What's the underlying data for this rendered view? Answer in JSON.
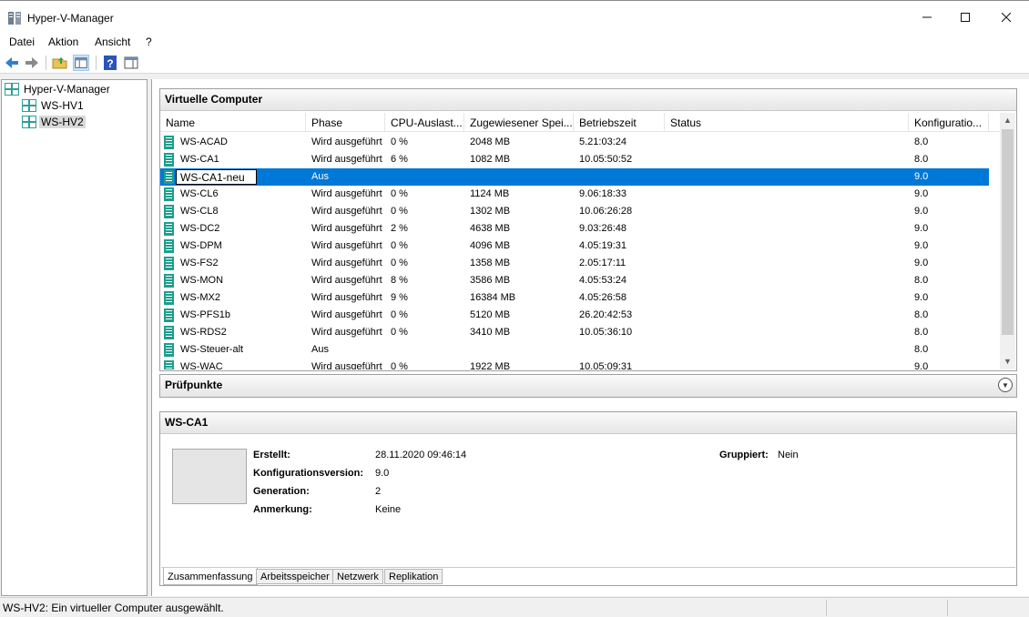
{
  "window": {
    "title": "Hyper-V-Manager"
  },
  "menu": {
    "items": [
      "Datei",
      "Aktion",
      "Ansicht",
      "?"
    ]
  },
  "tree": {
    "root": "Hyper-V-Manager",
    "servers": [
      "WS-HV1",
      "WS-HV2"
    ],
    "selected": "WS-HV2"
  },
  "vm_section": {
    "title": "Virtuelle Computer",
    "columns": [
      "Name",
      "Phase",
      "CPU-Auslast...",
      "Zugewiesener Spei...",
      "Betriebszeit",
      "Status",
      "Konfiguratio..."
    ],
    "rows": [
      {
        "name": "WS-ACAD",
        "phase": "Wird ausgeführt",
        "cpu": "0 %",
        "mem": "2048 MB",
        "uptime": "5.21:03:24",
        "status": "",
        "config": "8.0"
      },
      {
        "name": "WS-CA1",
        "phase": "Wird ausgeführt",
        "cpu": "6 %",
        "mem": "1082 MB",
        "uptime": "10.05:50:52",
        "status": "",
        "config": "8.0"
      },
      {
        "name": "WS-CA1-neu",
        "phase": "Aus",
        "cpu": "",
        "mem": "",
        "uptime": "",
        "status": "",
        "config": "9.0",
        "selected": true,
        "editing": true
      },
      {
        "name": "WS-CL6",
        "phase": "Wird ausgeführt",
        "cpu": "0 %",
        "mem": "1124 MB",
        "uptime": "9.06:18:33",
        "status": "",
        "config": "9.0"
      },
      {
        "name": "WS-CL8",
        "phase": "Wird ausgeführt",
        "cpu": "0 %",
        "mem": "1302 MB",
        "uptime": "10.06:26:28",
        "status": "",
        "config": "9.0"
      },
      {
        "name": "WS-DC2",
        "phase": "Wird ausgeführt",
        "cpu": "2 %",
        "mem": "4638 MB",
        "uptime": "9.03:26:48",
        "status": "",
        "config": "9.0"
      },
      {
        "name": "WS-DPM",
        "phase": "Wird ausgeführt",
        "cpu": "0 %",
        "mem": "4096 MB",
        "uptime": "4.05:19:31",
        "status": "",
        "config": "9.0"
      },
      {
        "name": "WS-FS2",
        "phase": "Wird ausgeführt",
        "cpu": "0 %",
        "mem": "1358 MB",
        "uptime": "2.05:17:11",
        "status": "",
        "config": "9.0"
      },
      {
        "name": "WS-MON",
        "phase": "Wird ausgeführt",
        "cpu": "8 %",
        "mem": "3586 MB",
        "uptime": "4.05:53:24",
        "status": "",
        "config": "8.0"
      },
      {
        "name": "WS-MX2",
        "phase": "Wird ausgeführt",
        "cpu": "9 %",
        "mem": "16384 MB",
        "uptime": "4.05:26:58",
        "status": "",
        "config": "9.0"
      },
      {
        "name": "WS-PFS1b",
        "phase": "Wird ausgeführt",
        "cpu": "0 %",
        "mem": "5120 MB",
        "uptime": "26.20:42:53",
        "status": "",
        "config": "8.0"
      },
      {
        "name": "WS-RDS2",
        "phase": "Wird ausgeführt",
        "cpu": "0 %",
        "mem": "3410 MB",
        "uptime": "10.05:36:10",
        "status": "",
        "config": "8.0"
      },
      {
        "name": "WS-Steuer-alt",
        "phase": "Aus",
        "cpu": "",
        "mem": "",
        "uptime": "",
        "status": "",
        "config": "8.0"
      },
      {
        "name": "WS-WAC",
        "phase": "Wird ausgeführt",
        "cpu": "0 %",
        "mem": "1922 MB",
        "uptime": "10.05:09:31",
        "status": "",
        "config": "9.0"
      }
    ]
  },
  "checkpoints": {
    "title": "Prüfpunkte"
  },
  "details": {
    "title": "WS-CA1",
    "created_label": "Erstellt:",
    "created_value": "28.11.2020 09:46:14",
    "config_label": "Konfigurationsversion:",
    "config_value": "9.0",
    "generation_label": "Generation:",
    "generation_value": "2",
    "notes_label": "Anmerkung:",
    "notes_value": "Keine",
    "grouped_label": "Gruppiert:",
    "grouped_value": "Nein",
    "tabs": [
      "Zusammenfassung",
      "Arbeitsspeicher",
      "Netzwerk",
      "Replikation"
    ]
  },
  "statusbar": {
    "text": "WS-HV2:  Ein virtueller Computer ausgewählt."
  },
  "colors": {
    "selection": "#0078d7",
    "vm_icon": "#1e9e8e"
  }
}
